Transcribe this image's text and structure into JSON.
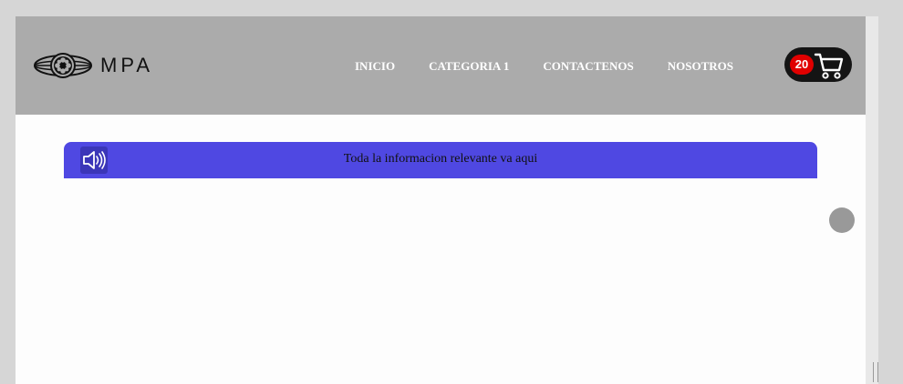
{
  "header": {
    "logo_text": "MPA",
    "logo_icon": "globe-film-reel-icon",
    "nav": [
      {
        "label": "INICIO"
      },
      {
        "label": "CATEGORIA 1"
      },
      {
        "label": "CONTACTENOS"
      },
      {
        "label": "NOSOTROS"
      }
    ],
    "cart": {
      "count": "20",
      "icon": "cart-icon",
      "badge_color": "#e00000"
    },
    "background": "#ababab"
  },
  "announcement": {
    "text": "Toda la informacion relevante va aqui",
    "icon": "speaker-icon",
    "background": "#4f48e2"
  }
}
